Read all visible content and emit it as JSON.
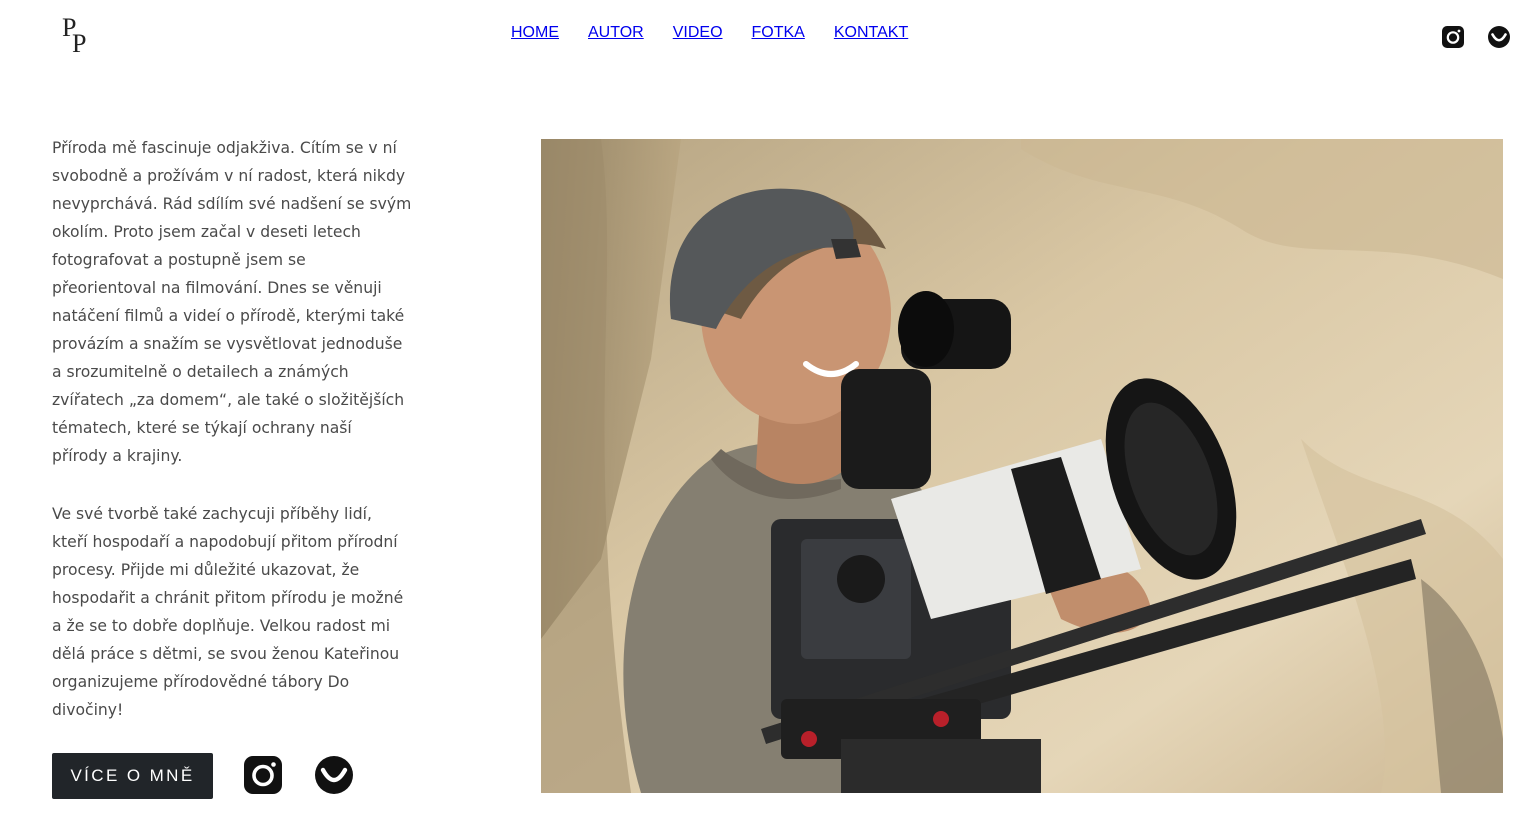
{
  "logo": {
    "alt": "PP"
  },
  "nav": {
    "items": [
      {
        "label": "HOME"
      },
      {
        "label": "AUTOR"
      },
      {
        "label": "VIDEO"
      },
      {
        "label": "FOTKA"
      },
      {
        "label": "KONTAKT"
      }
    ]
  },
  "header_icons": [
    "instagram-icon",
    "vimeo-smile-icon"
  ],
  "bio": {
    "paragraph1": "Příroda mě fascinuje odjakživa. Cítím se v ní svobodně a prožívám v ní radost, která nikdy nevyprchává. Rád sdílím své nadšení se svým okolím. Proto jsem začal v deseti letech fotografovat a postupně jsem se přeorientoval na filmování. Dnes se věnuji natáčení filmů a videí o přírodě, kterými také provázím a snažím se vysvětlovat jednoduše a srozumitelně o detailech a známých zvířatech „za domem“, ale také o složitějších tématech, které se týkají ochrany naší přírody a krajiny.",
    "paragraph2": "Ve své tvorbě také zachycuji příběhy lidí, kteří hospodaří a napodobují přitom přírodní procesy. Přijde mi důležité ukazovat, že hospodařit a chránit přitom přírodu je možné a že se to dobře doplňuje. Velkou radost mi dělá práce s dětmi, se svou ženou Kateřinou organizujeme přírodovědné tábory Do divočiny!"
  },
  "cta": {
    "label": "VÍCE O MNĚ"
  },
  "colors": {
    "button_bg": "#212529",
    "text": "#4a4a4a",
    "nav": "#2b2b2b"
  }
}
